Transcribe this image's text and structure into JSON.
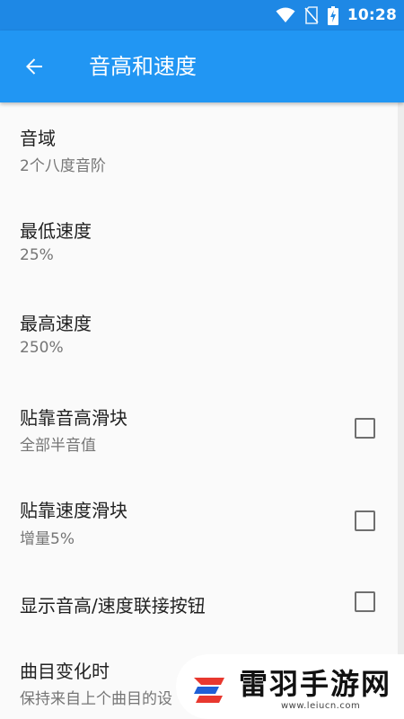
{
  "status_bar": {
    "time": "10:28",
    "icons": [
      "wifi-icon",
      "no-sim-icon",
      "battery-charging-icon"
    ]
  },
  "app_bar": {
    "back_icon": "arrow-back-icon",
    "title": "音高和速度"
  },
  "settings": [
    {
      "title": "音域",
      "summary": "2个八度音阶",
      "has_checkbox": false
    },
    {
      "title": "最低速度",
      "summary": "25%",
      "has_checkbox": false
    },
    {
      "title": "最高速度",
      "summary": "250%",
      "has_checkbox": false
    },
    {
      "title": "贴靠音高滑块",
      "summary": "全部半音值",
      "has_checkbox": true,
      "checked": false
    },
    {
      "title": "贴靠速度滑块",
      "summary": "增量5%",
      "has_checkbox": true,
      "checked": false
    },
    {
      "title": "显示音高/速度联接按钮",
      "summary": "",
      "has_checkbox": true,
      "checked": false
    },
    {
      "title": "曲目变化时",
      "summary": "保持来自上个曲目的设",
      "has_checkbox": false
    }
  ],
  "watermark": {
    "name": "雷羽手游网",
    "url": "www.leiucn.com"
  },
  "colors": {
    "status_bar": "#1e88e5",
    "app_bar": "#2196f3",
    "background": "#fafafa",
    "title_text": "#212121",
    "summary_text": "#757575",
    "checkbox_border": "#6f6f6f",
    "logo_red": "#e8382f",
    "logo_blue": "#1f5fd6"
  }
}
